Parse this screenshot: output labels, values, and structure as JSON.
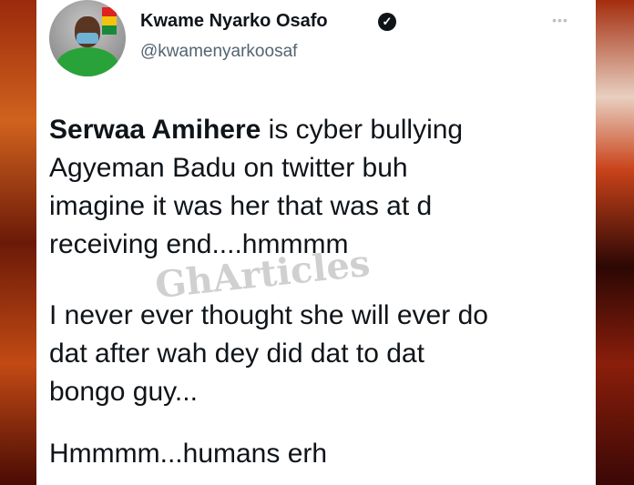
{
  "tweet": {
    "author": {
      "display_name": "Kwame Nyarko Osafo",
      "handle": "@kwamenyarkoosaf",
      "verified_icon": "verified-badge-icon",
      "verified_glyph": "✓"
    },
    "more_glyph": "•••",
    "paragraphs": {
      "p1_bold": "Serwaa Amihere",
      "p1_rest_line1": " is cyber bullying",
      "p1_line2": "Agyeman Badu on twitter buh",
      "p1_line3": "imagine it was her that was at d",
      "p1_line4": "receiving end....hmmmm",
      "p2_line1": "I never ever thought she will ever do",
      "p2_line2": "dat after wah dey did dat to dat",
      "p2_line3": "bongo guy...",
      "p3_line1": "Hmmmm...humans erh"
    }
  },
  "watermark": "GhArticles",
  "colors": {
    "text": "#0f1419",
    "handle": "#536471",
    "background": "#ffffff"
  }
}
